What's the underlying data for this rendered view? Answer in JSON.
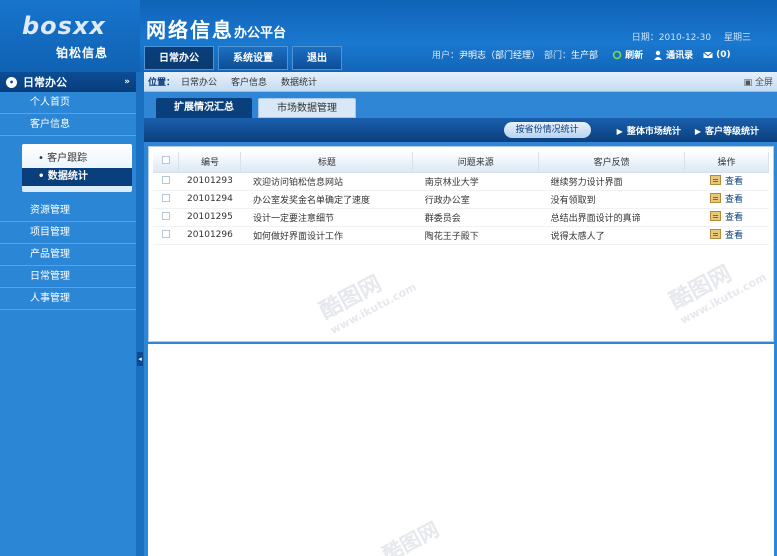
{
  "header": {
    "logo_text": "bosxx",
    "logo_sub": "铂松信息",
    "platform_big": "网络信息",
    "platform_small": "办公平台",
    "date": "日期：2010-12-30",
    "weekday": "星期三"
  },
  "nav": {
    "items": [
      "日常办公",
      "系统设置",
      "退出"
    ],
    "active_index": 0
  },
  "userbar": {
    "user_label": "用户：",
    "user_value": "尹明志（部门经理）",
    "dept_label": "部门：",
    "dept_value": "生产部",
    "refresh": "刷新",
    "addressbook": "通讯录",
    "mail_count": "(0)"
  },
  "sidebar": {
    "title": "日常办公",
    "items": [
      "个人首页",
      "客户信息"
    ],
    "sub_items": [
      "客户跟踪",
      "数据统计"
    ],
    "sub_active_index": 1,
    "items2": [
      "资源管理",
      "项目管理",
      "产品管理",
      "日常管理",
      "人事管理"
    ]
  },
  "breadcrumb": {
    "pos_label": "位置：",
    "trail": [
      "日常办公",
      "客户信息",
      "数据统计"
    ],
    "fullscreen": "全屏"
  },
  "tabs": [
    "扩展情况汇总",
    "市场数据管理"
  ],
  "toolbar": {
    "pill": "按省份情况统计",
    "links": [
      "整体市场统计",
      "客户等级统计"
    ]
  },
  "table": {
    "headers": [
      "编号",
      "标题",
      "问题来源",
      "客户反馈",
      "操作"
    ],
    "rows": [
      {
        "id": "20101293",
        "title": "欢迎访问铂松信息网站",
        "source": "南京林业大学",
        "feedback": "继续努力设计界面",
        "op": "查看"
      },
      {
        "id": "20101294",
        "title": "办公室发奖金名单确定了速度",
        "source": "行政办公室",
        "feedback": "没有领取到",
        "op": "查看"
      },
      {
        "id": "20101295",
        "title": "设计一定要注意细节",
        "source": "群委员会",
        "feedback": "总结出界面设计的真谛",
        "op": "查看"
      },
      {
        "id": "20101296",
        "title": "如何做好界面设计工作",
        "source": "陶花王子殿下",
        "feedback": "说得太感人了",
        "op": "查看"
      }
    ]
  },
  "watermark": {
    "logo": "酷图网",
    "url": "www.ikutu.com"
  }
}
